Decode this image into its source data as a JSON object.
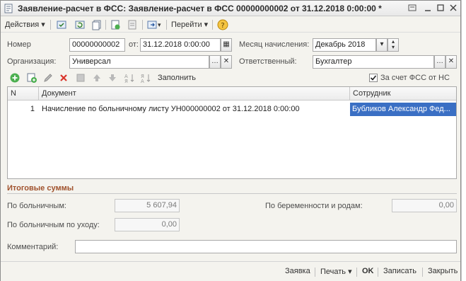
{
  "window": {
    "title": "Заявление-расчет в ФСС: Заявление-расчет в ФСС 00000000002 от 31.12.2018 0:00:00 *"
  },
  "toolbar": {
    "actions_label": "Действия",
    "goto_label": "Перейти"
  },
  "header": {
    "number_label": "Номер",
    "number_value": "00000000002",
    "date_label": "от:",
    "date_value": "31.12.2018  0:00:00",
    "month_label": "Месяц начисления:",
    "month_value": "Декабрь 2018",
    "org_label": "Организация:",
    "org_value": "Универсал",
    "resp_label": "Ответственный:",
    "resp_value": "Бухгалтер"
  },
  "table_toolbar": {
    "fill_label": "Заполнить",
    "fss_checkbox_label": "За счет ФСС от НС",
    "fss_checked": true
  },
  "table": {
    "columns": [
      "N",
      "Документ",
      "Сотрудник"
    ],
    "rows": [
      {
        "n": "1",
        "document": "Начисление по больничному листу УН000000002 от 31.12.2018 0:00:00",
        "employee": "Бубликов Александр Фед..."
      }
    ]
  },
  "totals": {
    "section_title": "Итоговые суммы",
    "sick_label": "По больничным:",
    "sick_value": "5 607,94",
    "maternity_label": "По беременности и родам:",
    "maternity_value": "0,00",
    "care_label": "По больничным по уходу:",
    "care_value": "0,00",
    "comment_label": "Комментарий:",
    "comment_value": ""
  },
  "footer": {
    "notice_label": "Заявка",
    "print_label": "Печать",
    "ok_label": "OK",
    "save_label": "Записать",
    "close_label": "Закрыть"
  },
  "colors": {
    "section_title": "#a0522d",
    "selected_cell": "#3a6fc4"
  }
}
